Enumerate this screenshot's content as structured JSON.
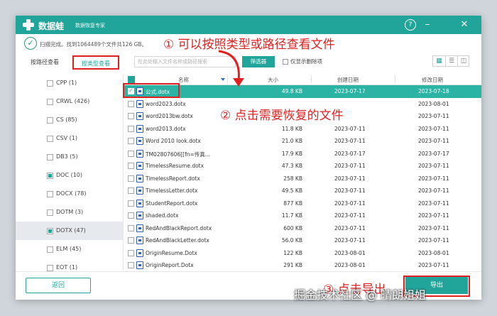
{
  "titlebar": {
    "app_name": "数据蛙",
    "app_subtitle": "数据恢复专家",
    "help_icon": "help-icon",
    "minimize_icon": "minimize-icon",
    "close_icon": "close-icon"
  },
  "status": {
    "text": "扫描完成。找到1064489个文件共126 GB。"
  },
  "annotations": {
    "step1": "① 可以按照类型或路径查看文件",
    "step2": "② 点击需要恢复的文件",
    "step3": "③ 点击导出"
  },
  "tabs": {
    "by_path": "按路径查看",
    "by_type": "按类型查看"
  },
  "search": {
    "placeholder": "在此处输入文件名称或路径搜索"
  },
  "filter_button": "筛选器",
  "deleted_only_label": "仅显示删除项",
  "view_toggles": [
    "grid-view-icon",
    "list-view-icon",
    "detail-view-icon"
  ],
  "file_types": [
    {
      "label": "CPP (1)",
      "state": "unchecked",
      "selected": false
    },
    {
      "label": "CRWL (426)",
      "state": "unchecked",
      "selected": false
    },
    {
      "label": "CS (85)",
      "state": "unchecked",
      "selected": false
    },
    {
      "label": "CSV (1)",
      "state": "unchecked",
      "selected": false
    },
    {
      "label": "DB3 (5)",
      "state": "unchecked",
      "selected": false
    },
    {
      "label": "DOC (10)",
      "state": "partial",
      "selected": false
    },
    {
      "label": "DOCX (78)",
      "state": "unchecked",
      "selected": false
    },
    {
      "label": "DOTM (3)",
      "state": "unchecked",
      "selected": false
    },
    {
      "label": "DOTX (47)",
      "state": "partial",
      "selected": true
    },
    {
      "label": "ELM (45)",
      "state": "unchecked",
      "selected": false
    },
    {
      "label": "EOT (1)",
      "state": "unchecked",
      "selected": false
    }
  ],
  "table": {
    "headers": {
      "name": "名称",
      "size": "大小",
      "created": "创建日期",
      "modified": "修改日期"
    },
    "rows": [
      {
        "name": "公式.dotx",
        "size": "49.8 KB",
        "created": "2023-07-17",
        "modified": "2023-07-18",
        "selected": true
      },
      {
        "name": "word2023.dotx",
        "size": "",
        "created": "",
        "modified": "2023-08-01",
        "selected": false
      },
      {
        "name": "word2013bw.dotx",
        "size": "",
        "created": "",
        "modified": "2023-07-11",
        "selected": false
      },
      {
        "name": "word2013.dotx",
        "size": "11.8 KB",
        "created": "2023-07-11",
        "modified": "2023-07-11",
        "selected": false
      },
      {
        "name": "Word 2010 look.dotx",
        "size": "21.0 KB",
        "created": "2023-07-11",
        "modified": "2023-07-11",
        "selected": false
      },
      {
        "name": "TM02807606[[fn=传真...",
        "size": "17.9 KB",
        "created": "2023-07-17",
        "modified": "2023-07-17",
        "selected": false
      },
      {
        "name": "TimelessResume.dotx",
        "size": "47.3 KB",
        "created": "2023-07-11",
        "modified": "2023-07-11",
        "selected": false
      },
      {
        "name": "TimelessReport.dotx",
        "size": "258 KB",
        "created": "2023-07-11",
        "modified": "2023-07-11",
        "selected": false
      },
      {
        "name": "TimelessLetter.dotx",
        "size": "49.5 KB",
        "created": "2023-07-11",
        "modified": "2023-07-11",
        "selected": false
      },
      {
        "name": "StudentReport.dotx",
        "size": "877 KB",
        "created": "2023-07-11",
        "modified": "2023-07-11",
        "selected": false
      },
      {
        "name": "shaded.dotx",
        "size": "11.7 KB",
        "created": "2023-07-11",
        "modified": "2023-07-11",
        "selected": false
      },
      {
        "name": "RedAndBlackReport.dotx",
        "size": "600 KB",
        "created": "2023-07-11",
        "modified": "2023-07-11",
        "selected": false
      },
      {
        "name": "RedAndBlackLetter.dotx",
        "size": "56.0 KB",
        "created": "2023-07-11",
        "modified": "2023-07-11",
        "selected": false
      },
      {
        "name": "OriginResume.Dotx",
        "size": "122 KB",
        "created": "2023-08-01",
        "modified": "2023-08-01",
        "selected": false
      },
      {
        "name": "OriginReport.Dotx",
        "size": "291 KB",
        "created": "2023-08-01",
        "modified": "2023-07-11",
        "selected": false
      }
    ]
  },
  "footer": {
    "back_label": "返回",
    "export_label": "导出"
  },
  "watermark": "掘金技术社区 @ 晴朗姐姐",
  "colors": {
    "accent": "#21a59a",
    "selected_row": "#2bb3a3",
    "annotation_red": "#e02121"
  }
}
